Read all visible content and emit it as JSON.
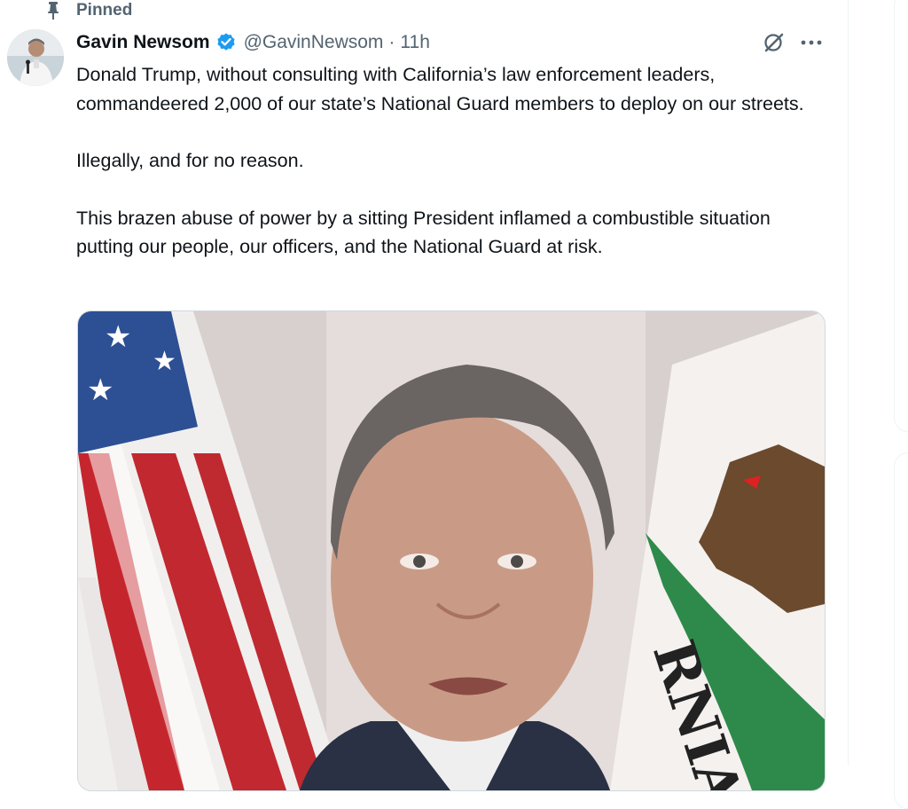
{
  "pinned": {
    "label": "Pinned",
    "icon": "pin-icon"
  },
  "author": {
    "name": "Gavin Newsom",
    "handle": "@GavinNewsom",
    "separator": "·",
    "time": "11h",
    "verified_icon": "verified-badge-icon"
  },
  "actions": {
    "grok_icon": "grok-icon",
    "more_icon": "more-icon"
  },
  "tweet": {
    "paragraphs": [
      "Donald Trump, without consulting with California’s law enforcement leaders, commandeered 2,000 of our state’s National Guard members to deploy on our streets.",
      "Illegally, and for no reason.",
      "This brazen abuse of power by a sitting President inflamed a combustible situation putting our people, our officers, and the National Guard at risk."
    ]
  },
  "media": {
    "flag_text": "RNIA"
  },
  "colors": {
    "verified": "#1d9bf0",
    "secondary_text": "#536471",
    "primary_text": "#0f1419"
  }
}
